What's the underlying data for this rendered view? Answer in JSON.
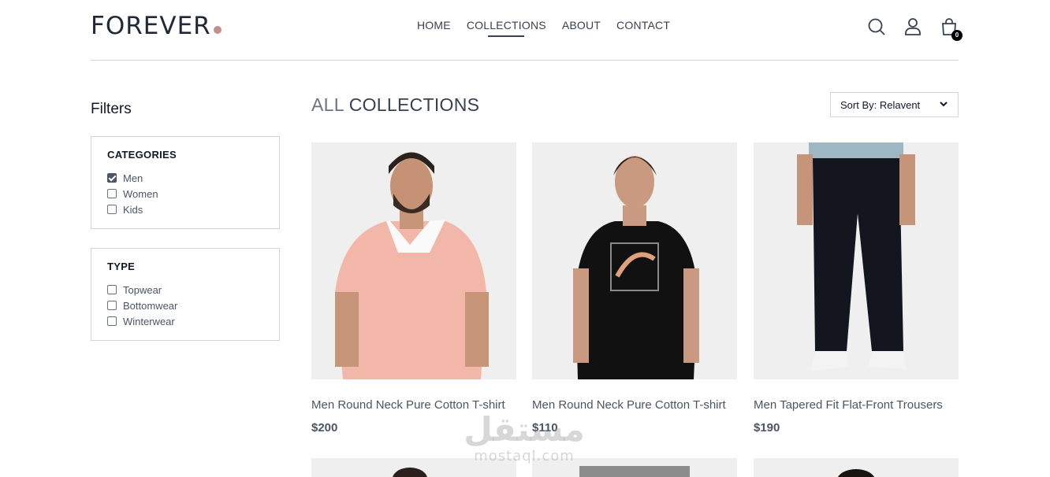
{
  "header": {
    "logo": "FOREVER",
    "nav": [
      {
        "label": "HOME"
      },
      {
        "label": "COLLECTIONS",
        "active": true
      },
      {
        "label": "ABOUT"
      },
      {
        "label": "CONTACT"
      }
    ],
    "cart_count": "0",
    "icons": [
      "search-icon",
      "profile-icon",
      "cart-icon"
    ]
  },
  "filters": {
    "title": "Filters",
    "categories": {
      "heading": "CATEGORIES",
      "options": [
        {
          "label": "Men",
          "checked": true
        },
        {
          "label": "Women",
          "checked": false
        },
        {
          "label": "Kids",
          "checked": false
        }
      ]
    },
    "type": {
      "heading": "TYPE",
      "options": [
        {
          "label": "Topwear",
          "checked": false
        },
        {
          "label": "Bottomwear",
          "checked": false
        },
        {
          "label": "Winterwear",
          "checked": false
        }
      ]
    }
  },
  "main": {
    "title_part1": "ALL",
    "title_part2": "COLLECTIONS",
    "sort_selected": "Sort By: Relavent",
    "products": [
      {
        "name": "Men Round Neck Pure Cotton T-shirt",
        "price": "$200"
      },
      {
        "name": "Men Round Neck Pure Cotton T-shirt",
        "price": "$110"
      },
      {
        "name": "Men Tapered Fit Flat-Front Trousers",
        "price": "$190"
      }
    ]
  },
  "watermark": {
    "arabic": "مستقل",
    "latin": "mostaql.com"
  },
  "colors": {
    "accent_dot": "#c0908d",
    "text": "#374151",
    "border": "#d1d5db",
    "image_bg": "#efefef"
  }
}
